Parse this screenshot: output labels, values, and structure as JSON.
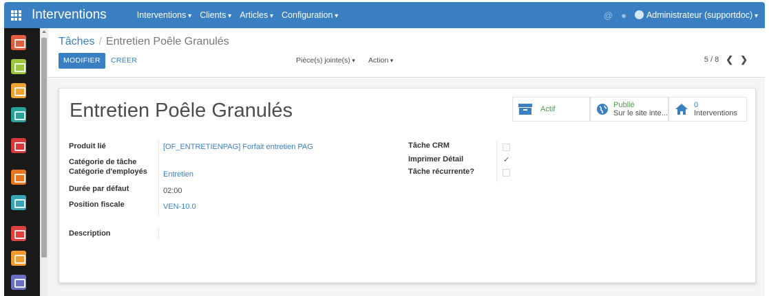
{
  "navbar": {
    "brand": "Interventions",
    "menus": [
      "Interventions",
      "Clients",
      "Articles",
      "Configuration"
    ],
    "user": "Administrateur (supportdoc)"
  },
  "sidebar": {
    "apps": [
      {
        "name": "discuss",
        "color": "#e05d40"
      },
      {
        "name": "calendar",
        "color": "#9bc53d"
      },
      {
        "name": "map",
        "color": "#f0a330"
      },
      {
        "name": "contacts",
        "color": "#27a39a"
      },
      {
        "name": "files",
        "color": "#d9383a"
      },
      {
        "name": "reporting",
        "color": "#e8761e"
      },
      {
        "name": "invoicing",
        "color": "#38a3b5"
      },
      {
        "name": "sales",
        "color": "#e0413c"
      },
      {
        "name": "documents",
        "color": "#f29a2e"
      },
      {
        "name": "apps",
        "color": "#6a6fc3"
      }
    ]
  },
  "control": {
    "breadcrumb_parent": "Tâches",
    "breadcrumb_sep": "/",
    "breadcrumb_current": "Entretien Poêle Granulés",
    "edit_label": "MODIFIER",
    "create_label": "CRÉER",
    "attachments_label": "Pièce(s) jointe(s)",
    "action_label": "Action",
    "pager": "5 / 8"
  },
  "form": {
    "title": "Entretien Poêle Granulés",
    "buttons": {
      "active_label": "Actif",
      "published_label": "Publié",
      "published_sub": "Sur le site inte...",
      "interventions_count": "0",
      "interventions_label": "Interventions"
    },
    "left_fields": [
      {
        "label": "Produit lié",
        "value": "[OF_ENTRETIENPAG] Forfait entretien PAG",
        "link": true
      },
      {
        "label": "Catégorie de tâche",
        "value": "",
        "link": false
      },
      {
        "label": "Catégorie d'employés",
        "value": "Entretien",
        "link": true
      },
      {
        "label": "Durée par défaut",
        "value": "02:00",
        "link": false
      },
      {
        "label": "Position fiscale",
        "value": "VEN-10.0",
        "link": true
      }
    ],
    "description_label": "Description",
    "right_fields": [
      {
        "label": "Tâche CRM",
        "checked": false
      },
      {
        "label": "Imprimer Détail",
        "checked": true
      },
      {
        "label": "Tâche récurrente?",
        "checked": false
      }
    ]
  }
}
